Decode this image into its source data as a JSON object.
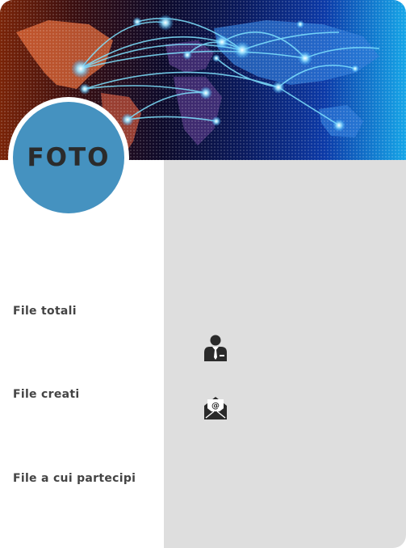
{
  "profile": {
    "photo_label": "FOTO"
  },
  "stats": [
    {
      "label": "File totali"
    },
    {
      "label": "File creati"
    },
    {
      "label": "File a cui partecipi"
    }
  ],
  "icons": {
    "user": "user-tie-icon",
    "mail": "mail-envelope-icon"
  },
  "colors": {
    "photo_circle": "#4592c0",
    "panel": "#dedede",
    "label_text": "#444444"
  }
}
